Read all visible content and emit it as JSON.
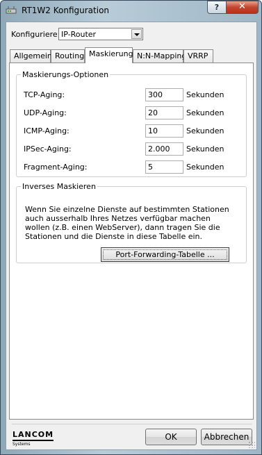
{
  "window": {
    "title": "RT1W2 Konfiguration",
    "help_label": "?",
    "close_label": "✕"
  },
  "config": {
    "label": "Konfiguriere:",
    "value": "IP-Router"
  },
  "tabs": [
    {
      "label": "Allgemein"
    },
    {
      "label": "Routing"
    },
    {
      "label": "Maskierung"
    },
    {
      "label": "N:N-Mapping"
    },
    {
      "label": "VRRP"
    }
  ],
  "masking_options": {
    "legend": "Maskierungs-Optionen",
    "rows": [
      {
        "label": "TCP-Aging:",
        "value": "300",
        "unit": "Sekunden"
      },
      {
        "label": "UDP-Aging:",
        "value": "20",
        "unit": "Sekunden"
      },
      {
        "label": "ICMP-Aging:",
        "value": "10",
        "unit": "Sekunden"
      },
      {
        "label": "IPSec-Aging:",
        "value": "2.000",
        "unit": "Sekunden"
      },
      {
        "label": "Fragment-Aging:",
        "value": "5",
        "unit": "Sekunden"
      }
    ]
  },
  "inverse_masking": {
    "legend": "Inverses Maskieren",
    "description": "Wenn Sie einzelne Dienste auf bestimmten Stationen auch ausserhalb Ihres Netzes verfügbar machen wollen (z.B. einen WebServer), dann tragen Sie die Stationen und die Dienste in diese Tabelle ein.",
    "button": "Port-Forwarding-Tabelle ..."
  },
  "footer": {
    "logo": "LANCOM",
    "logo_sub": "Systems",
    "ok": "OK",
    "cancel": "Abbrechen"
  }
}
